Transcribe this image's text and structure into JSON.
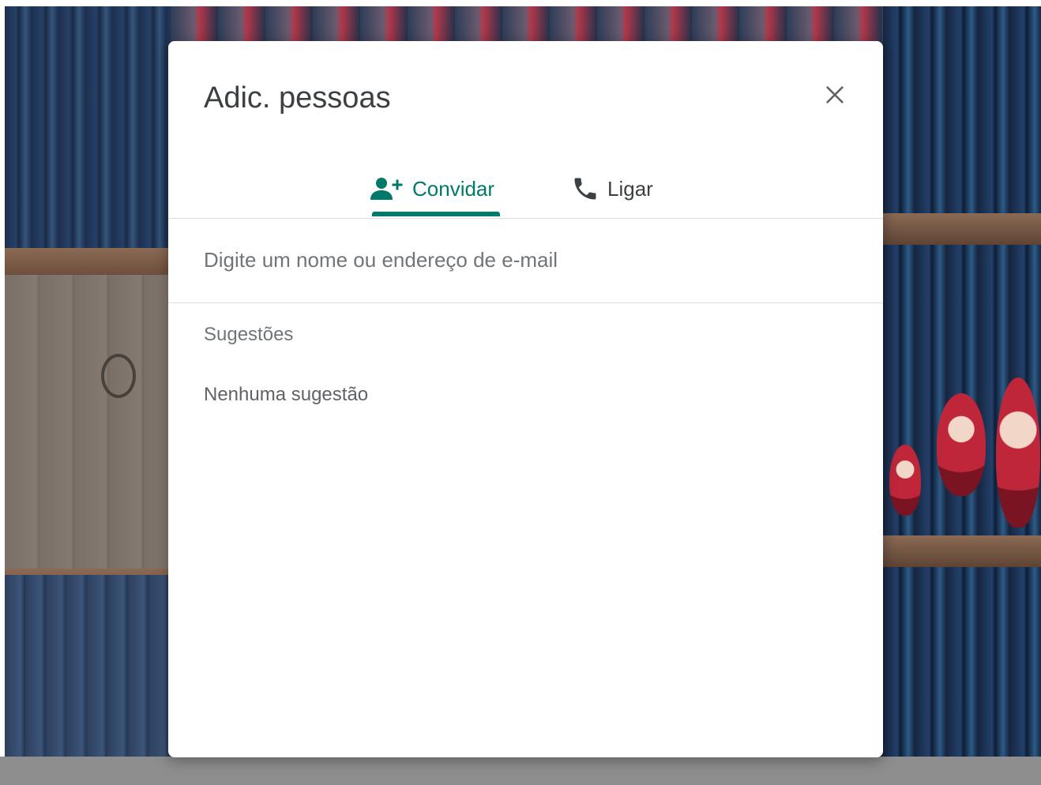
{
  "dialog": {
    "title": "Adic. pessoas",
    "close_icon": "close-icon",
    "tabs": [
      {
        "label": "Convidar",
        "icon": "person-add-icon",
        "selected": true
      },
      {
        "label": "Ligar",
        "icon": "phone-icon",
        "selected": false
      }
    ],
    "search": {
      "value": "",
      "placeholder": "Digite um nome ou endereço de e-mail"
    },
    "suggestions": {
      "heading": "Sugestões",
      "empty_text": "Nenhuma sugestão"
    }
  },
  "colors": {
    "accent": "#00796b",
    "title_text": "#3c4043",
    "secondary_text": "#70757a",
    "divider": "#dadce0"
  }
}
